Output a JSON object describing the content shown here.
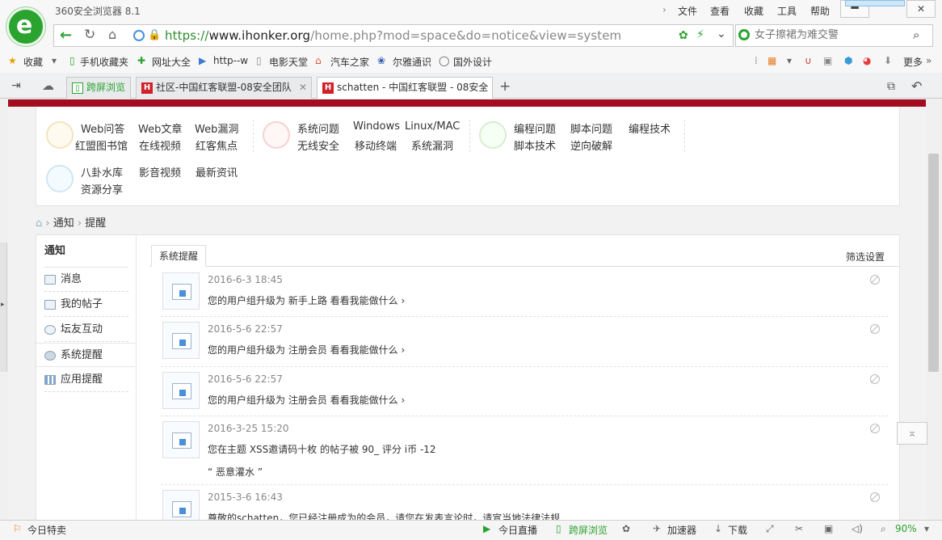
{
  "window": {
    "title": "360安全浏览器 8.1",
    "menu": [
      "文件",
      "查看",
      "收藏",
      "工具",
      "帮助"
    ]
  },
  "address": {
    "url_scheme": "https://",
    "url_domain": "www.ihonker.org",
    "url_path": "/home.php?mod=space&do=notice&view=system",
    "search_placeholder": "女子擦裙为难交警"
  },
  "favorites": {
    "label": "收藏",
    "items": [
      "手机收藏夹",
      "网址大全",
      "http--w",
      "电影天堂",
      "汽车之家",
      "尔雅通识",
      "国外设计"
    ],
    "more": "更多"
  },
  "tabs": [
    {
      "label": "跨屏浏览",
      "active": false
    },
    {
      "label": "社区-中国红客联盟-08安全团队",
      "active": false
    },
    {
      "label": "schatten - 中国红客联盟 - 08安全",
      "active": true
    }
  ],
  "categories": [
    {
      "icon": "book-icon",
      "links": [
        [
          "Web问答",
          "Web文章",
          "Web漏洞"
        ],
        [
          "红盟图书馆",
          "在线视频",
          "红客焦点"
        ]
      ]
    },
    {
      "icon": "flame-icon",
      "links": [
        [
          "系统问题",
          "Windows",
          "Linux/MAC"
        ],
        [
          "无线安全",
          "移动终端",
          "系统漏洞"
        ]
      ]
    },
    {
      "icon": "code-icon",
      "links": [
        [
          "编程问题",
          "脚本问题",
          "编程技术"
        ],
        [
          "脚本技术",
          "逆向破解"
        ]
      ]
    },
    {
      "icon": "gear-icon",
      "links": [
        [
          "八卦水库",
          "影音视频",
          "最新资讯"
        ],
        [
          "资源分享"
        ]
      ]
    }
  ],
  "breadcrumb": [
    "通知",
    "提醒"
  ],
  "sidebar": {
    "title": "通知",
    "items": [
      {
        "label": "消息",
        "active": false
      },
      {
        "label": "我的帖子",
        "active": false
      },
      {
        "label": "坛友互动",
        "active": false
      },
      {
        "label": "系统提醒",
        "active": true
      },
      {
        "label": "应用提醒",
        "active": false
      }
    ]
  },
  "content": {
    "tab": "系统提醒",
    "filter": "筛选设置",
    "notices": [
      {
        "time": "2016-6-3 18:45",
        "text": "您的用户组升级为 新手上路   看看我能做什么 ›",
        "quote": ""
      },
      {
        "time": "2016-5-6 22:57",
        "text": "您的用户组升级为 注册会员   看看我能做什么 ›",
        "quote": ""
      },
      {
        "time": "2016-5-6 22:57",
        "text": "您的用户组升级为 注册会员   看看我能做什么 ›",
        "quote": ""
      },
      {
        "time": "2016-3-25 15:20",
        "text": "您在主题 XSS邀请码十枚 的帖子被 90_ 评分 i币 -12",
        "quote": "“ 恶意灌水 ”"
      },
      {
        "time": "2015-3-6 16:43",
        "text": "尊敬的schatten，您已经注册成为的会员，请您在发表言论时，请宣当地法律法规",
        "quote": ""
      }
    ]
  },
  "status": {
    "left": "今日特卖",
    "items": [
      "今日直播",
      "跨屏浏览",
      "加速器",
      "下载"
    ],
    "zoom": "90%"
  },
  "colors": {
    "brand_green": "#2ba32f",
    "hk_red": "#a30d1f"
  }
}
